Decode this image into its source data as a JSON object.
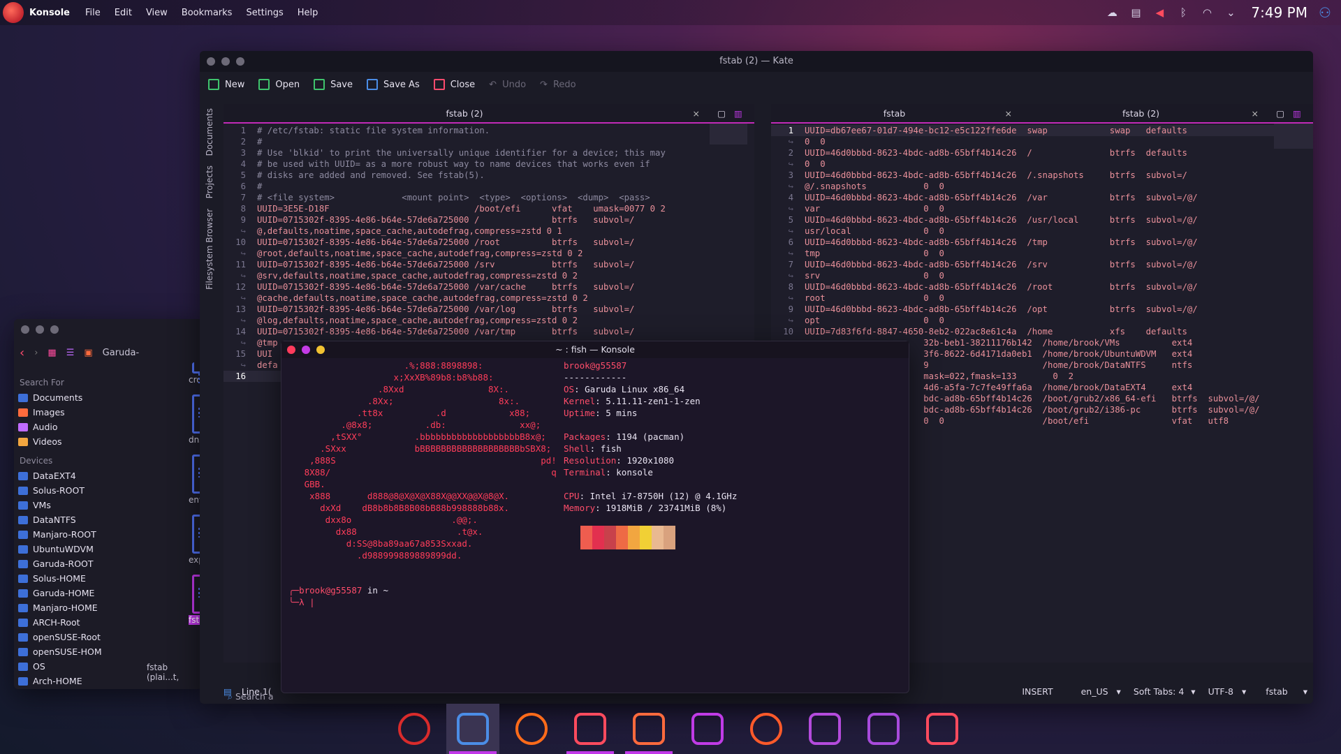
{
  "panel": {
    "app_name": "Konsole",
    "menus": [
      "File",
      "Edit",
      "View",
      "Bookmarks",
      "Settings",
      "Help"
    ],
    "clock": "7:49 PM"
  },
  "dolphin": {
    "location": "Garuda-",
    "search_header": "Search For",
    "search_items": [
      "Documents",
      "Images",
      "Audio",
      "Videos"
    ],
    "devices_header": "Devices",
    "devices": [
      "DataEXT4",
      "Solus-ROOT",
      "VMs",
      "DataNTFS",
      "Manjaro-ROOT",
      "UbuntuWDVM",
      "Garuda-ROOT",
      "Solus-HOME",
      "Garuda-HOME",
      "Manjaro-HOME",
      "ARCH-Root",
      "openSUSE-Root",
      "openSUSE-HOM",
      "OS",
      "Arch-HOME"
    ],
    "files": [
      "cron.d",
      "dnsmas",
      "environ",
      "expo",
      "fsta"
    ],
    "status": "fstab (plai...t,"
  },
  "kate": {
    "title": "fstab (2) — Kate",
    "toolbar": {
      "new": "New",
      "open": "Open",
      "save": "Save",
      "save_as": "Save As",
      "close": "Close",
      "undo": "Undo",
      "redo": "Redo"
    },
    "side_tabs": [
      "Documents",
      "Projects",
      "Filesystem Browser"
    ],
    "left_tab": "fstab (2)",
    "right_tabs": [
      "fstab",
      "fstab (2)"
    ],
    "left_lines": [
      {
        "n": "1",
        "t": "# /etc/fstab: static file system information.",
        "c": true
      },
      {
        "n": "2",
        "t": "#",
        "c": true
      },
      {
        "n": "3",
        "t": "# Use 'blkid' to print the universally unique identifier for a device; this may",
        "c": true
      },
      {
        "n": "4",
        "t": "# be used with UUID= as a more robust way to name devices that works even if",
        "c": true
      },
      {
        "n": "5",
        "t": "# disks are added and removed. See fstab(5).",
        "c": true
      },
      {
        "n": "6",
        "t": "#",
        "c": true
      },
      {
        "n": "7",
        "t": "# <file system>             <mount point>  <type>  <options>  <dump>  <pass>",
        "c": true
      },
      {
        "n": "8",
        "t": "UUID=3E5E-D18F                            /boot/efi      vfat    umask=0077 0 2"
      },
      {
        "n": "9",
        "t": "UUID=0715302f-8395-4e86-b64e-57de6a725000 /              btrfs   subvol=/"
      },
      {
        "n": "↪",
        "t": "@,defaults,noatime,space_cache,autodefrag,compress=zstd 0 1"
      },
      {
        "n": "10",
        "t": "UUID=0715302f-8395-4e86-b64e-57de6a725000 /root          btrfs   subvol=/"
      },
      {
        "n": "↪",
        "t": "@root,defaults,noatime,space_cache,autodefrag,compress=zstd 0 2"
      },
      {
        "n": "11",
        "t": "UUID=0715302f-8395-4e86-b64e-57de6a725000 /srv           btrfs   subvol=/"
      },
      {
        "n": "↪",
        "t": "@srv,defaults,noatime,space_cache,autodefrag,compress=zstd 0 2"
      },
      {
        "n": "12",
        "t": "UUID=0715302f-8395-4e86-b64e-57de6a725000 /var/cache     btrfs   subvol=/"
      },
      {
        "n": "↪",
        "t": "@cache,defaults,noatime,space_cache,autodefrag,compress=zstd 0 2"
      },
      {
        "n": "13",
        "t": "UUID=0715302f-8395-4e86-b64e-57de6a725000 /var/log       btrfs   subvol=/"
      },
      {
        "n": "↪",
        "t": "@log,defaults,noatime,space_cache,autodefrag,compress=zstd 0 2"
      },
      {
        "n": "14",
        "t": "UUID=0715302f-8395-4e86-b64e-57de6a725000 /var/tmp       btrfs   subvol=/"
      },
      {
        "n": "↪",
        "t": "@tmp"
      },
      {
        "n": "15",
        "t": "UUI"
      },
      {
        "n": "↪",
        "t": "defa"
      },
      {
        "n": "16",
        "t": ""
      }
    ],
    "right_lines": [
      {
        "n": "1",
        "t": "UUID=db67ee67-01d7-494e-bc12-e5c122ffe6de  swap            swap   defaults"
      },
      {
        "n": "↪",
        "t": "0  0"
      },
      {
        "n": "2",
        "t": "UUID=46d0bbbd-8623-4bdc-ad8b-65bff4b14c26  /               btrfs  defaults"
      },
      {
        "n": "↪",
        "t": "0  0"
      },
      {
        "n": "3",
        "t": "UUID=46d0bbbd-8623-4bdc-ad8b-65bff4b14c26  /.snapshots     btrfs  subvol=/"
      },
      {
        "n": "↪",
        "t": "@/.snapshots           0  0"
      },
      {
        "n": "4",
        "t": "UUID=46d0bbbd-8623-4bdc-ad8b-65bff4b14c26  /var            btrfs  subvol=/@/"
      },
      {
        "n": "↪",
        "t": "var                    0  0"
      },
      {
        "n": "5",
        "t": "UUID=46d0bbbd-8623-4bdc-ad8b-65bff4b14c26  /usr/local      btrfs  subvol=/@/"
      },
      {
        "n": "↪",
        "t": "usr/local              0  0"
      },
      {
        "n": "6",
        "t": "UUID=46d0bbbd-8623-4bdc-ad8b-65bff4b14c26  /tmp            btrfs  subvol=/@/"
      },
      {
        "n": "↪",
        "t": "tmp                    0  0"
      },
      {
        "n": "7",
        "t": "UUID=46d0bbbd-8623-4bdc-ad8b-65bff4b14c26  /srv            btrfs  subvol=/@/"
      },
      {
        "n": "↪",
        "t": "srv                    0  0"
      },
      {
        "n": "8",
        "t": "UUID=46d0bbbd-8623-4bdc-ad8b-65bff4b14c26  /root           btrfs  subvol=/@/"
      },
      {
        "n": "↪",
        "t": "root                   0  0"
      },
      {
        "n": "9",
        "t": "UUID=46d0bbbd-8623-4bdc-ad8b-65bff4b14c26  /opt            btrfs  subvol=/@/"
      },
      {
        "n": "↪",
        "t": "opt                    0  0"
      },
      {
        "n": "10",
        "t": "UUID=7d83f6fd-8847-4650-8eb2-022ac8e61c4a  /home           xfs    defaults"
      },
      {
        "n": "",
        "t": "                       32b-beb1-38211176b142  /home/brook/VMs          ext4"
      },
      {
        "n": "",
        "t": "                       3f6-8622-6d4171da0eb1  /home/brook/UbuntuWDVM   ext4"
      },
      {
        "n": "",
        "t": "                       9                      /home/brook/DataNTFS     ntfs"
      },
      {
        "n": "",
        "t": "                       mask=022,fmask=133       0  2"
      },
      {
        "n": "",
        "t": "                       4d6-a5fa-7c7fe49ffa6a  /home/brook/DataEXT4     ext4"
      },
      {
        "n": "",
        "t": "                       bdc-ad8b-65bff4b14c26  /boot/grub2/x86_64-efi   btrfs  subvol=/@/"
      },
      {
        "n": "",
        "t": "                       bdc-ad8b-65bff4b14c26  /boot/grub2/i386-pc      btrfs  subvol=/@/"
      },
      {
        "n": "",
        "t": "                       0  0                   /boot/efi                vfat   utf8"
      }
    ],
    "status": {
      "line": "Line 1(",
      "mode": "INSERT",
      "lang": "en_US",
      "tabs": "Soft Tabs: 4",
      "encoding": "UTF-8",
      "syntax": "fstab",
      "search": "Search a"
    }
  },
  "konsole": {
    "title": "~ : fish — Konsole",
    "ascii_art": "                      .%;888:8898898:\n                    x;XxXB%89b8:b8%b88:\n                 .8Xxd                8X:.\n               .8Xx;                    8x:.\n             .tt8x          .d            x88;\n          .@8x8;          .db:              xx@;\n        ,tSXX°          .bbbbbbbbbbbbbbbbbbbB8x@;\n      .SXxx             bBBBBBBBBBBBBBBBBBBBbSBX8;\n    ,888S                                       pd!\n   8X88/                                          q\n   GBB.\n    x888       d888@8@X@X@X88X@@XX@@X@8@X.\n      dxXd    dB8b8b8B8B08bB88b998888b88x.\n       dxx8o                   .@@;.\n         dx88                   .t@x.\n           d:SS@8ba89aa67a853Sxxad.\n             .d988999889889899dd.",
    "user_host": "brook@g55587",
    "separator": "------------",
    "info": [
      {
        "k": "OS",
        "v": "Garuda Linux x86_64"
      },
      {
        "k": "Kernel",
        "v": "5.11.11-zen1-1-zen"
      },
      {
        "k": "Uptime",
        "v": "5 mins"
      },
      {
        "k": "",
        "v": ""
      },
      {
        "k": "Packages",
        "v": "1194 (pacman)"
      },
      {
        "k": "Shell",
        "v": "fish"
      },
      {
        "k": "Resolution",
        "v": "1920x1080"
      },
      {
        "k": "Terminal",
        "v": "konsole"
      },
      {
        "k": "",
        "v": ""
      },
      {
        "k": "CPU",
        "v": "Intel i7-8750H (12) @ 4.1GHz"
      },
      {
        "k": "Memory",
        "v": "1918MiB / 23741MiB (8%)"
      }
    ],
    "swatch_colors": [
      "#ef5d4f",
      "#e2304f",
      "#c8414b",
      "#ee6a45",
      "#f2a640",
      "#f1d035",
      "#e9b991",
      "#d9a27e"
    ],
    "prompt_user": "brook@g55587",
    "prompt_rest": " in ~",
    "prompt_symbol": "λ"
  },
  "dock": {
    "apps": [
      {
        "name": "garuda-logo-icon",
        "color": "#d92b2b"
      },
      {
        "name": "konsole-icon",
        "color": "#4b8de6"
      },
      {
        "name": "firedragon-icon",
        "color": "#ff6b1a"
      },
      {
        "name": "file-manager-icon",
        "color": "#ff4b5e"
      },
      {
        "name": "text-editor-icon",
        "color": "#ff6a3d"
      },
      {
        "name": "settings-icon",
        "color": "#c03be6"
      },
      {
        "name": "music-icon",
        "color": "#ff5a2a"
      },
      {
        "name": "software-store-icon",
        "color": "#b44bdc"
      },
      {
        "name": "kde-connect-icon",
        "color": "#a84bdc"
      },
      {
        "name": "screenshot-icon",
        "color": "#ff4b5e"
      }
    ]
  }
}
